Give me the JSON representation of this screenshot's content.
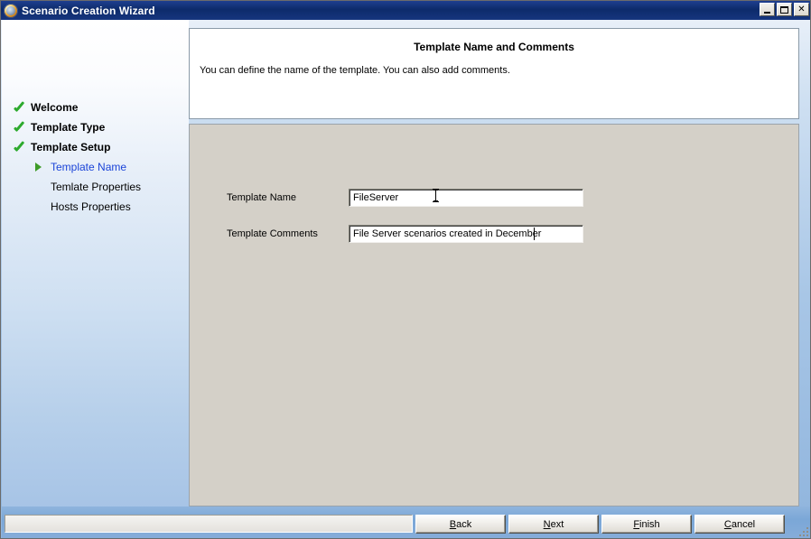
{
  "window": {
    "title": "Scenario Creation Wizard",
    "icon": "globe-icon",
    "controls": {
      "minimize": "minimize-button",
      "maximize": "maximize-button",
      "close_label": "✕"
    }
  },
  "sidebar": {
    "items": [
      {
        "label": "Welcome",
        "marker": "check-icon",
        "level": "main",
        "state": "completed"
      },
      {
        "label": "Template Type",
        "marker": "check-icon",
        "level": "main",
        "state": "completed"
      },
      {
        "label": "Template Setup",
        "marker": "check-icon",
        "level": "main",
        "state": "completed"
      },
      {
        "label": "Template Name",
        "marker": "arrow-icon",
        "level": "sub",
        "state": "current"
      },
      {
        "label": "Temlate Properties",
        "marker": "none",
        "level": "sub",
        "state": "pending"
      },
      {
        "label": "Hosts Properties",
        "marker": "none",
        "level": "sub",
        "state": "pending"
      }
    ]
  },
  "header": {
    "title": "Template Name and Comments",
    "description": "You can define the name of the template. You can also add comments."
  },
  "form": {
    "template_name": {
      "label": "Template Name",
      "value": "FileServer",
      "placeholder": ""
    },
    "template_comments": {
      "label": "Template Comments",
      "value": "File Server scenarios created in December",
      "placeholder": ""
    }
  },
  "footer": {
    "status_text": "",
    "buttons": [
      {
        "name": "back",
        "prefix": "",
        "accel": "B",
        "suffix": "ack"
      },
      {
        "name": "next",
        "prefix": "",
        "accel": "N",
        "suffix": "ext"
      },
      {
        "name": "finish",
        "prefix": "",
        "accel": "F",
        "suffix": "inish"
      },
      {
        "name": "cancel",
        "prefix": "",
        "accel": "C",
        "suffix": "ancel"
      }
    ]
  },
  "colors": {
    "titlebar": "#0d2b6b",
    "accent_blue": "#1b44d8",
    "check_green": "#2eaa2e",
    "arrow_green": "#3e9b28",
    "panel_gray": "#d4d0c8",
    "footer_blue": "#7ba7d7"
  }
}
